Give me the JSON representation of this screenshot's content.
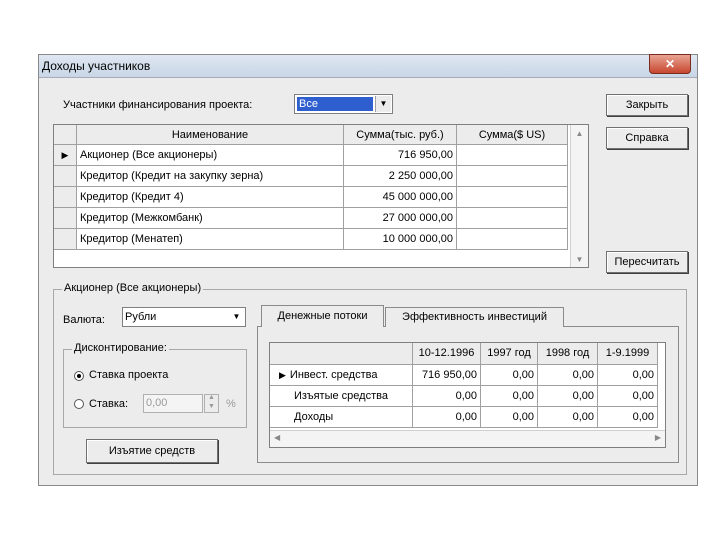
{
  "window": {
    "title": "Доходы участников",
    "close_glyph": "✕"
  },
  "participants": {
    "label": "Участники финансирования проекта:",
    "selected": "Все"
  },
  "buttons": {
    "close": "Закрыть",
    "help": "Справка",
    "recalc": "Пересчитать",
    "withdraw": "Изъятие средств"
  },
  "grid": {
    "columns": [
      "Наименование",
      "Сумма(тыс. руб.)",
      "Сумма($ US)"
    ],
    "rows": [
      {
        "name": "Акционер (Все акционеры)",
        "rub": "716 950,00",
        "usd": "",
        "current": true
      },
      {
        "name": "Кредитор (Кредит на закупку зерна)",
        "rub": "2 250 000,00",
        "usd": ""
      },
      {
        "name": "Кредитор (Кредит 4)",
        "rub": "45 000 000,00",
        "usd": ""
      },
      {
        "name": "Кредитор (Межкомбанк)",
        "rub": "27 000 000,00",
        "usd": ""
      },
      {
        "name": "Кредитор (Менатеп)",
        "rub": "10 000 000,00",
        "usd": ""
      }
    ]
  },
  "shareholder": {
    "group_label": "Акционер (Все акционеры)",
    "currency_label": "Валюта:",
    "currency": "Рубли"
  },
  "discount": {
    "group_label": "Дисконтирование:",
    "option_project": "Ставка проекта",
    "option_rate": "Ставка:",
    "rate_value": "0,00",
    "percent": "%"
  },
  "tabs": {
    "cashflow": "Денежные потоки",
    "efficiency": "Эффективность инвестиций"
  },
  "cashflow": {
    "columns": [
      "10-12.1996",
      "1997 год",
      "1998 год",
      "1-9.1999"
    ],
    "rows": [
      {
        "label": "Инвест. средства",
        "values": [
          "716 950,00",
          "0,00",
          "0,00",
          "0,00"
        ],
        "current": true
      },
      {
        "label": "Изъятые средства",
        "values": [
          "0,00",
          "0,00",
          "0,00",
          "0,00"
        ]
      },
      {
        "label": "Доходы",
        "values": [
          "0,00",
          "0,00",
          "0,00",
          "0,00"
        ]
      }
    ]
  }
}
